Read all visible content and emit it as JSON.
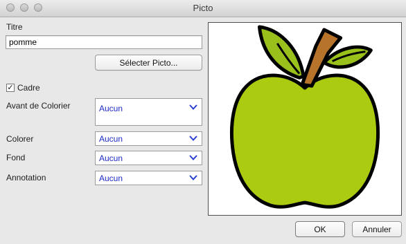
{
  "window": {
    "title": "Picto"
  },
  "form": {
    "titre_label": "Titre",
    "titre_value": "pomme",
    "select_picto_label": "Sélecter Picto...",
    "cadre_label": "Cadre",
    "cadre_checked": true,
    "avant_label": "Avant de Colorier",
    "avant_value": "Aucun",
    "colorer_label": "Colorer",
    "colorer_value": "Aucun",
    "fond_label": "Fond",
    "fond_value": "Aucun",
    "annotation_label": "Annotation",
    "annotation_value": "Aucun"
  },
  "buttons": {
    "ok": "OK",
    "cancel": "Annuler"
  },
  "colors": {
    "apple": "#aacb10",
    "stem": "#b8732a",
    "leaf": "#9ac01c",
    "outline": "#000000",
    "dropdown_text": "#1b2bc9"
  },
  "icons": {
    "picture": "apple-icon",
    "dropdown": "chevron-down-icon",
    "check": "checkmark-icon"
  }
}
